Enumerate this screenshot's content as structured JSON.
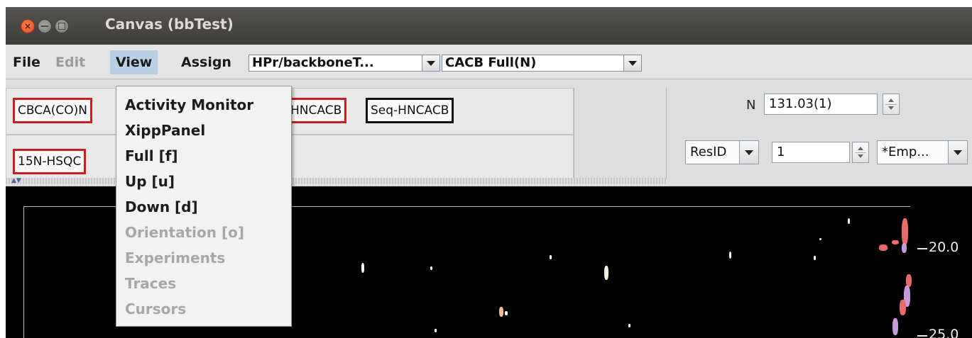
{
  "window": {
    "title": "Canvas (bbTest)"
  },
  "menubar": {
    "file": "File",
    "edit": "Edit",
    "view": "View",
    "assign": "Assign",
    "project_combo": "HPr/backboneT...",
    "mode_combo": "CACB Full(N)"
  },
  "experiments": {
    "row1": [
      "CBCA(CO)N",
      "HNCACB",
      "Seq-HNCACB"
    ],
    "row2": [
      "15N-HSQC"
    ]
  },
  "control": {
    "axis_label": "N",
    "axis_value": "131.03(1)",
    "resid_combo": "ResID",
    "resid_value": "1",
    "empty_combo": "*Emp..."
  },
  "canvas": {
    "ticks": [
      "20.0",
      "25.0"
    ]
  },
  "view_menu": {
    "items": [
      {
        "label": "Activity Monitor",
        "enabled": true
      },
      {
        "label": "XippPanel",
        "enabled": true
      },
      {
        "label": "Full [f]",
        "enabled": true
      },
      {
        "label": "Up [u]",
        "enabled": true
      },
      {
        "label": "Down [d]",
        "enabled": true
      },
      {
        "label": "Orientation [o]",
        "enabled": false
      },
      {
        "label": "Experiments",
        "enabled": false
      },
      {
        "label": "Traces",
        "enabled": false
      },
      {
        "label": "Cursors",
        "enabled": false
      }
    ]
  },
  "colors": {
    "selected_border": "#cc1f1f",
    "active_border": "#111111",
    "peak_pink": "#e86a6a",
    "peak_violet": "#c79ad9",
    "menu_highlight": "#b8cfe5"
  }
}
